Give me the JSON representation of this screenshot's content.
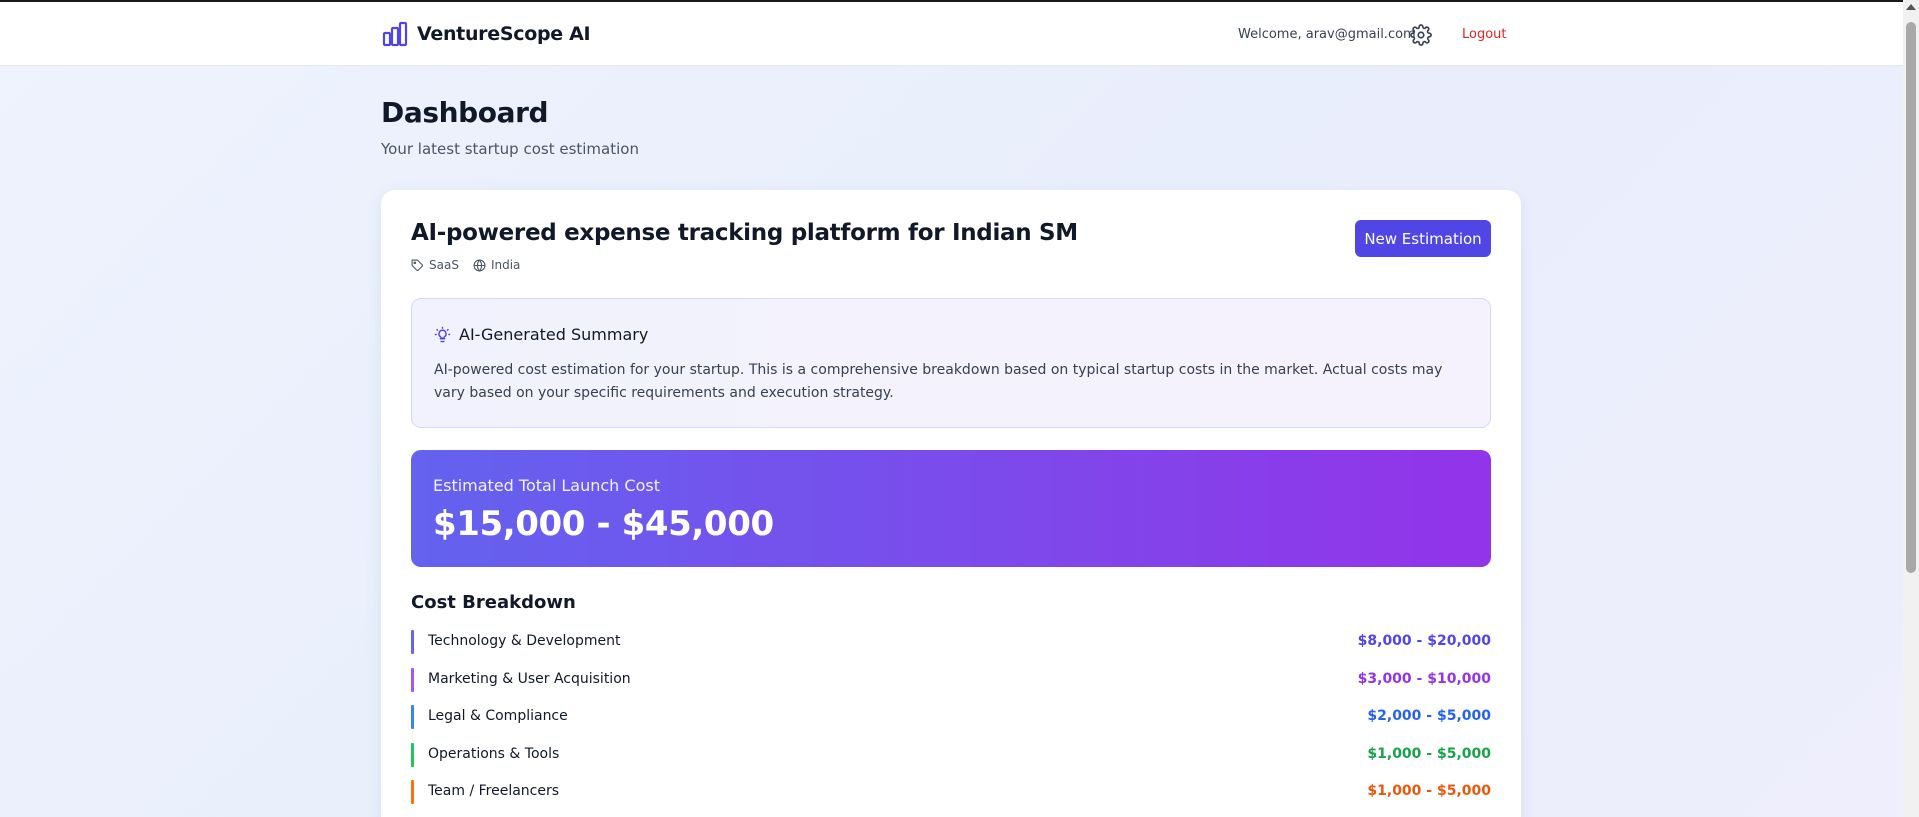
{
  "header": {
    "brand": "VentureScope AI",
    "welcome": "Welcome, arav@gmail.com",
    "logout": "Logout",
    "brand_icon": "bar-chart-icon",
    "settings_icon": "gear-icon"
  },
  "page": {
    "title": "Dashboard",
    "subtitle": "Your latest startup cost estimation"
  },
  "estimation": {
    "title": "AI-powered expense tracking platform for Indian SM",
    "new_button": "New Estimation",
    "tags": [
      {
        "icon": "tag-icon",
        "label": "SaaS"
      },
      {
        "icon": "globe-icon",
        "label": "India"
      }
    ],
    "summary": {
      "icon": "lightbulb-icon",
      "title": "AI-Generated Summary",
      "text": "AI-powered cost estimation for your startup. This is a comprehensive breakdown based on typical startup costs in the market. Actual costs may vary based on your specific requirements and execution strategy."
    },
    "total": {
      "label": "Estimated Total Launch Cost",
      "value": "$15,000 - $45,000"
    },
    "breakdown": {
      "title": "Cost Breakdown",
      "items": [
        {
          "label": "Technology & Development",
          "amount": "$8,000 - $20,000",
          "color": "#4f46e5",
          "bar": "#6366f1"
        },
        {
          "label": "Marketing & User Acquisition",
          "amount": "$3,000 - $10,000",
          "color": "#9333ea",
          "bar": "#a855f7"
        },
        {
          "label": "Legal & Compliance",
          "amount": "$2,000 - $5,000",
          "color": "#2563eb",
          "bar": "#3b82f6"
        },
        {
          "label": "Operations & Tools",
          "amount": "$1,000 - $5,000",
          "color": "#16a34a",
          "bar": "#22c55e"
        },
        {
          "label": "Team / Freelancers",
          "amount": "$1,000 - $5,000",
          "color": "#ea580c",
          "bar": "#f97316"
        }
      ]
    }
  },
  "colors": {
    "accent": "#4f46e5",
    "logout": "#dc2626"
  }
}
